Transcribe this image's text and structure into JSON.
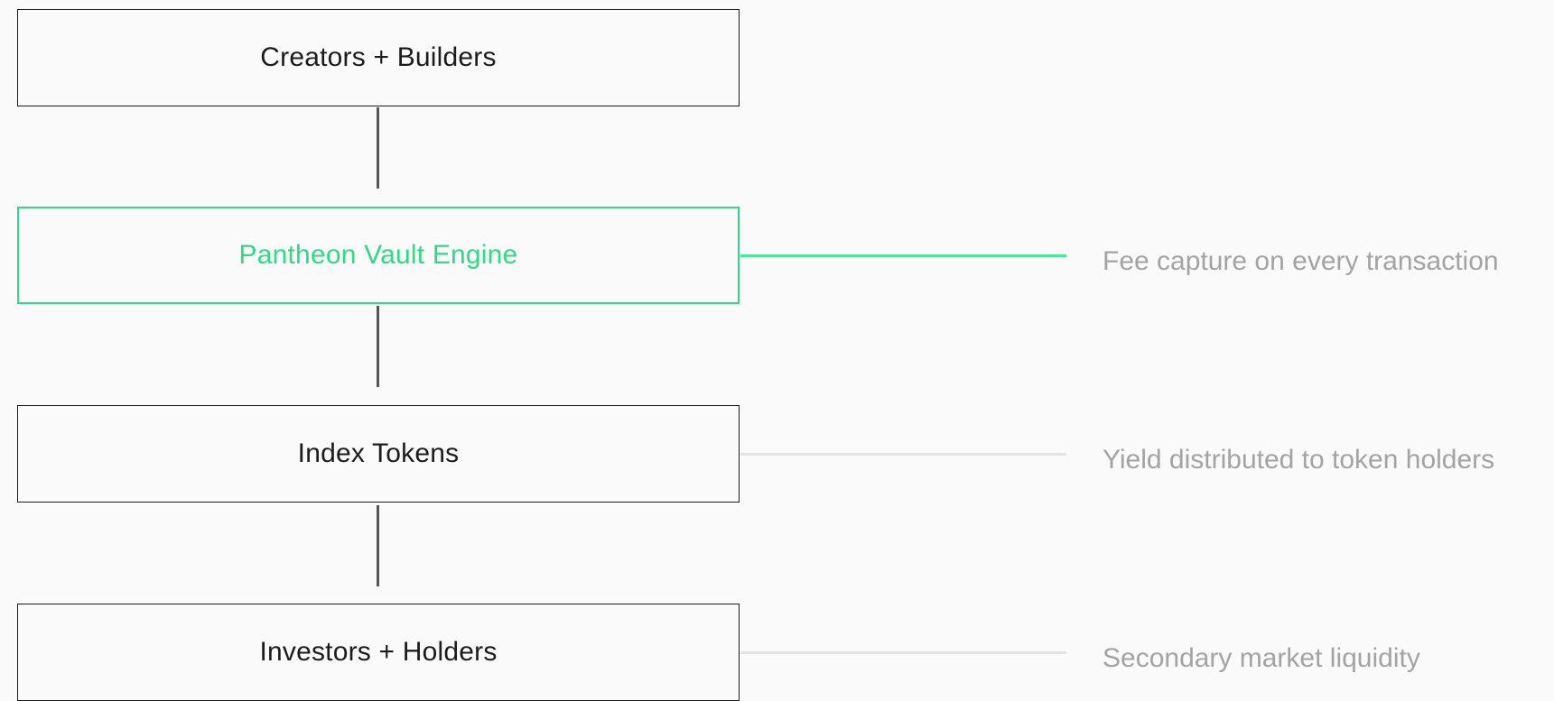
{
  "diagram": {
    "nodes": [
      {
        "id": "creators-builders",
        "label": "Creators + Builders",
        "accent": false
      },
      {
        "id": "pantheon-vault-engine",
        "label": "Pantheon Vault Engine",
        "accent": true
      },
      {
        "id": "index-tokens",
        "label": "Index Tokens",
        "accent": false
      },
      {
        "id": "investors-holders",
        "label": "Investors + Holders",
        "accent": false
      }
    ],
    "annotations": [
      {
        "attached_to": "pantheon-vault-engine",
        "text": "Fee capture on every transaction"
      },
      {
        "attached_to": "index-tokens",
        "text": "Yield distributed to token holders"
      },
      {
        "attached_to": "investors-holders",
        "text": "Secondary market liquidity"
      }
    ]
  },
  "colors": {
    "accent": "#2edb84",
    "accent_line": "#4fe39a",
    "node_border": "#1c1c1c",
    "node_text": "#1c1c1c",
    "vertical_connector": "#555555",
    "annotation_line": "#e3e3e3",
    "annotation_text": "#a3a3a3",
    "background": "#fafafa"
  }
}
